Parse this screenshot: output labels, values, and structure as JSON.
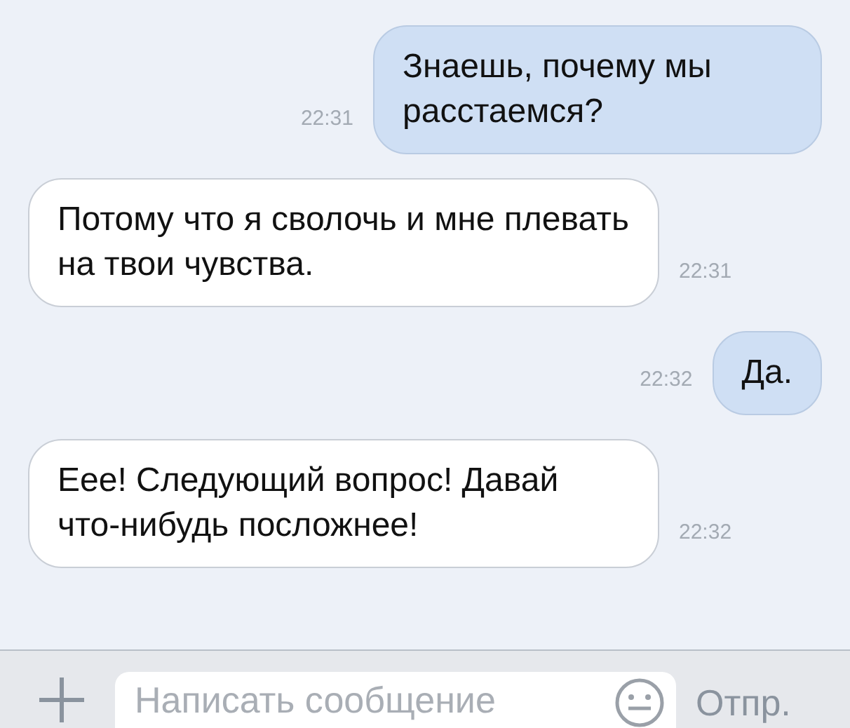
{
  "messages": [
    {
      "kind": "outgoing",
      "text": "Знаешь, почему мы расстаемся?",
      "time": "22:31"
    },
    {
      "kind": "incoming",
      "text": "Потому что я сволочь и мне плевать на твои чувства.",
      "time": "22:31"
    },
    {
      "kind": "outgoing",
      "text": "Да.",
      "time": "22:32"
    },
    {
      "kind": "incoming",
      "text": "Еее! Следующий вопрос! Давай что-нибудь посложнее!",
      "time": "22:32"
    }
  ],
  "composer": {
    "placeholder": "Написать сообщение",
    "send": "Отпр."
  }
}
